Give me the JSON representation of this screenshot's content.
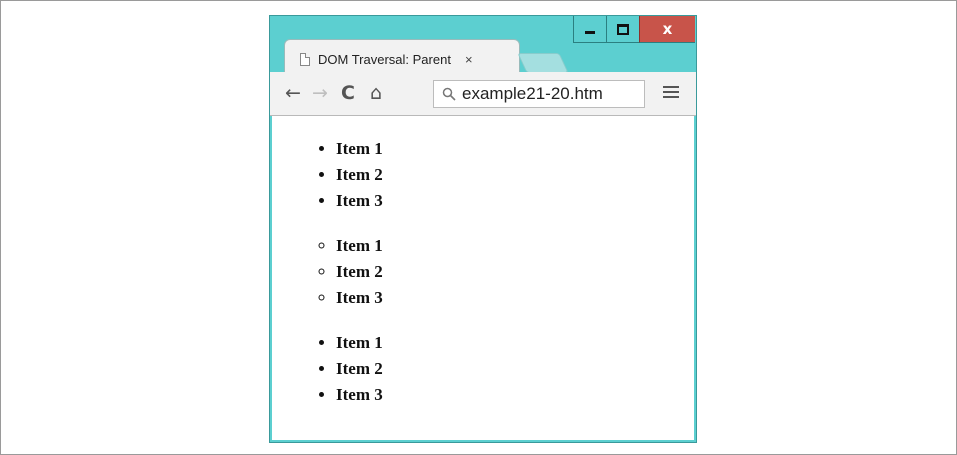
{
  "window": {
    "controls": {
      "minimize": "minimize",
      "maximize": "maximize",
      "close": "x"
    }
  },
  "tab": {
    "title": "DOM Traversal: Parent",
    "close_label": "×"
  },
  "toolbar": {
    "back_icon": "←",
    "forward_icon": "→",
    "reload_icon": "C",
    "home_icon": "⌂",
    "url": "example21-20.htm"
  },
  "content": {
    "lists": [
      {
        "style": "disc",
        "items": [
          "Item 1",
          "Item 2",
          "Item 3"
        ]
      },
      {
        "style": "circle",
        "items": [
          "Item 1",
          "Item 2",
          "Item 3"
        ]
      },
      {
        "style": "disc",
        "items": [
          "Item 1",
          "Item 2",
          "Item 3"
        ]
      }
    ]
  },
  "colors": {
    "window_frame": "#5ccfd0",
    "close_button": "#c8544a",
    "toolbar_bg": "#f2f2f2"
  }
}
